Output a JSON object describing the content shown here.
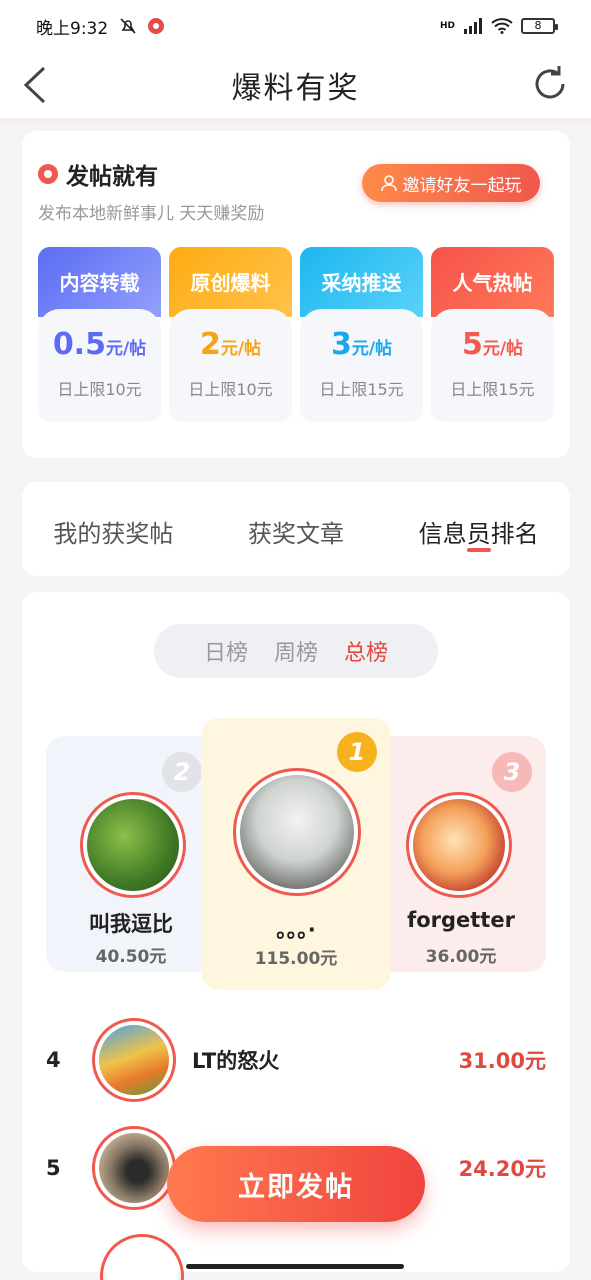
{
  "status": {
    "time": "晚上9:32",
    "network": "HD",
    "battery": "8"
  },
  "nav": {
    "title": "爆料有奖"
  },
  "promo": {
    "title": "发帖就有",
    "subtitle": "发布本地新鲜事儿 天天赚奖励",
    "invite_label": "邀请好友一起玩",
    "tiles": [
      {
        "name": "内容转载",
        "amount": "0.5",
        "unit": "元/帖",
        "limit": "日上限10元"
      },
      {
        "name": "原创爆料",
        "amount": "2",
        "unit": "元/帖",
        "limit": "日上限10元"
      },
      {
        "name": "采纳推送",
        "amount": "3",
        "unit": "元/帖",
        "limit": "日上限15元"
      },
      {
        "name": "人气热帖",
        "amount": "5",
        "unit": "元/帖",
        "limit": "日上限15元"
      }
    ]
  },
  "tabs": [
    "我的获奖帖",
    "获奖文章",
    "信息员排名"
  ],
  "period": {
    "options": [
      "日榜",
      "周榜",
      "总榜"
    ],
    "selected": "总榜"
  },
  "podium": {
    "first": {
      "rank": "1",
      "name": "。。。·",
      "amount": "115.00元"
    },
    "second": {
      "rank": "2",
      "name": "叫我逗比",
      "amount": "40.50元"
    },
    "third": {
      "rank": "3",
      "name": "forgetter",
      "amount": "36.00元"
    }
  },
  "rows": [
    {
      "rank": "4",
      "name": "LT的怒火",
      "amount": "31.00元"
    },
    {
      "rank": "5",
      "name": "",
      "amount": "24.20元"
    }
  ],
  "fab_label": "立即发帖"
}
